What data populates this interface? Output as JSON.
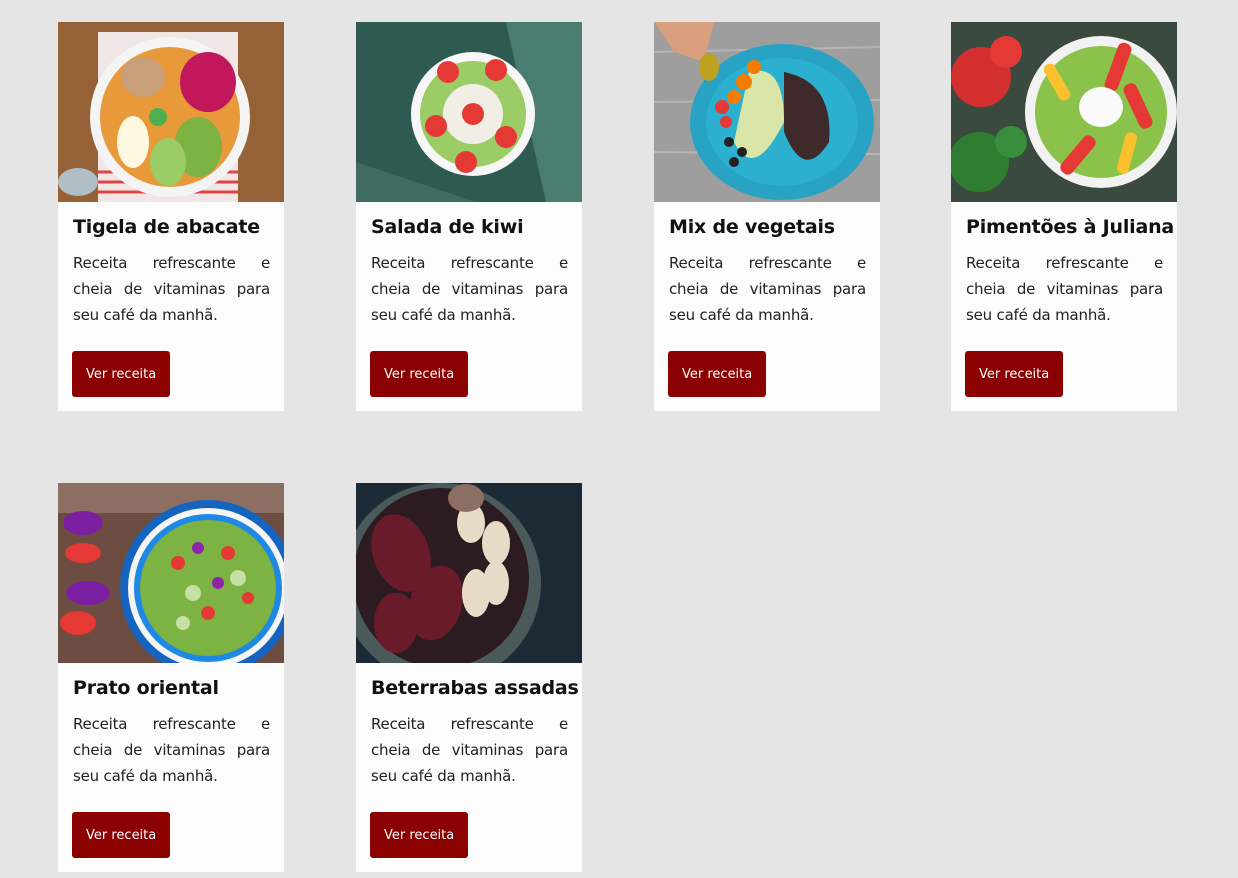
{
  "recipes": [
    {
      "title": "Tigela de abacate",
      "description": "Receita refrescante e cheia de vitaminas para seu café da manhã.",
      "button_label": "Ver receita",
      "image": "acai-bowl-photo"
    },
    {
      "title": "Salada de kiwi",
      "description": "Receita refrescante e cheia de vitaminas para seu café da manhã.",
      "button_label": "Ver receita",
      "image": "kiwi-bowl-photo"
    },
    {
      "title": "Mix de vegetais",
      "description": "Receita refrescante e cheia de vitaminas para seu café da manhã.",
      "button_label": "Ver receita",
      "image": "vegetable-plate-photo"
    },
    {
      "title": "Pimentões à Juliana",
      "description": "Receita refrescante e cheia de vitaminas para seu café da manhã.",
      "button_label": "Ver receita",
      "image": "peppers-salad-photo"
    },
    {
      "title": "Prato oriental",
      "description": "Receita refrescante e cheia de vitaminas para seu café da manhã.",
      "button_label": "Ver receita",
      "image": "oriental-salad-photo"
    },
    {
      "title": "Beterrabas assadas",
      "description": "Receita refrescante e cheia de vitaminas para seu café da manhã.",
      "button_label": "Ver receita",
      "image": "roasted-beets-photo"
    }
  ],
  "colors": {
    "button_bg": "#8b0000",
    "page_bg": "#e5e5e5",
    "card_bg": "#fcfcfc"
  }
}
